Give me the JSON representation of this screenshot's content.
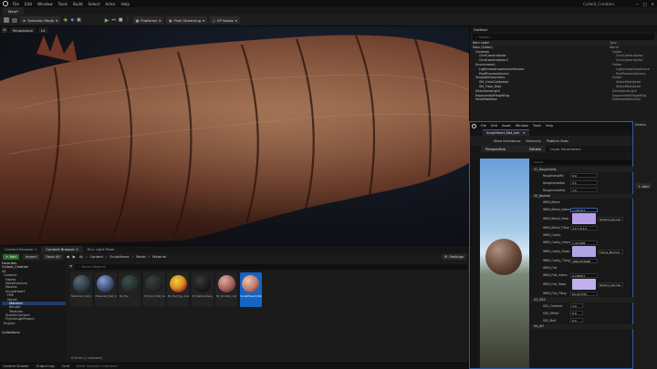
{
  "window": {
    "title": "Colloid_Creation",
    "project_tab": "Main*"
  },
  "menu": [
    "File",
    "Edit",
    "Window",
    "Tools",
    "Build",
    "Select",
    "Actor",
    "Help"
  ],
  "toolbar": {
    "mode": "Selection Mode",
    "platforms": "Platforms",
    "pixel_streaming": "Pixel Streaming",
    "vp_nodes": "VP Nodes"
  },
  "viewport": {
    "perspective": "Perspective",
    "lit": "Lit"
  },
  "content_browser": {
    "tabs": [
      "Content Browser 1",
      "Content Browser 2",
      "Env. Light Mixer"
    ],
    "add": "+ Add",
    "import": "Import",
    "save_all": "Save All",
    "breadcrumb": [
      "All",
      "Content",
      "SculptHeart",
      "Model",
      "Material"
    ],
    "search_placeholder": "Search Material",
    "settings": "Settings",
    "favorites": "Favorites",
    "project_root": "Colloid_Creation",
    "tree": [
      "All",
      "Content",
      "Hands",
      "MetaHumans",
      "Movies",
      "SculptHeart",
      "FBX",
      "Model",
      "Material",
      "Render",
      "Textures",
      "StarterContent",
      "FlythroughProject",
      "Engine"
    ],
    "assets": [
      {
        "label": "Material1_Mat_Inst",
        "color": "#2a3a44"
      },
      {
        "label": "Material2_Mat_Inst",
        "color": "#3a4a6c"
      },
      {
        "label": "MI_Eye",
        "color": "#23302e"
      },
      {
        "label": "MI_Eye2_Mat_Inst",
        "color": "#222828"
      },
      {
        "label": "MI_Mat_Eye_Inst",
        "color": "#d89020"
      },
      {
        "label": "MI_MetaSurface_inst",
        "color": "#2a2a2a"
      },
      {
        "label": "MI_SkinMat_inst",
        "color": "#a05f5a"
      },
      {
        "label": "SculptHeart_Mat_Inst",
        "color": "#b87a70"
      }
    ],
    "item_count": "8 items (1 selected)",
    "collections": "Collections"
  },
  "outliner": {
    "title": "Outliner",
    "search_placeholder": "Search...",
    "col_label": "Item Label",
    "col_type": "Type",
    "rows": [
      {
        "label": "Main (Editor)",
        "type": "World"
      },
      {
        "label": "Cameras",
        "type": "Folder"
      },
      {
        "label": "CineCameraActor",
        "type": "CineCameraActor"
      },
      {
        "label": "CineCameraActor2",
        "type": "CineCameraActor"
      },
      {
        "label": "Environment",
        "type": "Folder"
      },
      {
        "label": "LightmassImportanceVolume",
        "type": "LightmassImportance"
      },
      {
        "label": "PostProcessVolume",
        "type": "PostProcessVolume"
      },
      {
        "label": "TemplateGeometry",
        "type": "Folder"
      },
      {
        "label": "SM_CubeCalibrator",
        "type": "StaticMeshActor"
      },
      {
        "label": "SM_Floor_Disk",
        "type": "StaticMeshActor"
      },
      {
        "label": "DirectionalLight",
        "type": "DirectionalLight"
      },
      {
        "label": "ExponentialHeightFog",
        "type": "ExponentialHeightFog"
      },
      {
        "label": "HeartSkeleton",
        "type": "SkeletalMeshActor"
      }
    ]
  },
  "material_editor": {
    "menu": [
      "File",
      "Edit",
      "Asset",
      "Window",
      "Tools",
      "Help"
    ],
    "tab": "SculptHeart_Mat_Inst",
    "toolbar": [
      "Show Inheritance",
      "Hierarchy",
      "Platform Stats"
    ],
    "details_tab": "Details",
    "layer_tab": "Layer Parameters",
    "viewport_label": "Perspective",
    "search_placeholder": "Search",
    "sections": [
      "01_Roughness",
      "02_Normal",
      "03_SSS",
      "04_AO"
    ],
    "roughness": [
      {
        "name": "RoughnessMin",
        "value": "0.0"
      },
      {
        "name": "RoughnessMax",
        "value": "0.5"
      },
      {
        "name": "RoughnessMult",
        "value": "1.0"
      }
    ],
    "normal": [
      {
        "name": "WRN_Blend",
        "value": ""
      },
      {
        "name": "WRN_Blend_Intens",
        "value": "1.797977"
      },
      {
        "name": "WRN_Blend_Mask",
        "value": "Stretch_Normal"
      },
      {
        "name": "WRN_Blend_Tiling",
        "value": "4.0  1.8  4.0"
      },
      {
        "name": "WRN_Cavity",
        "value": ""
      },
      {
        "name": "WRN_Cavity_Intens",
        "value": "1.317486"
      },
      {
        "name": "WRN_Cavity_Mask",
        "value": "Tissue_Normal"
      },
      {
        "name": "WRN_Cavity_Tiling",
        "value": "1864.879988"
      },
      {
        "name": "WRN_Flat",
        "value": ""
      },
      {
        "name": "WRN_Flat_Intens",
        "value": "0.186871"
      },
      {
        "name": "WRN_Flat_Mask",
        "value": "Stretch_Normal"
      },
      {
        "name": "WRN_Flat_Tiling",
        "value": "60.417370"
      }
    ],
    "sss": [
      {
        "name": "SSS_Contrast",
        "value": "1.0"
      },
      {
        "name": "SSS_Offset",
        "value": "0.0"
      },
      {
        "name": "SSS_Mult",
        "value": "0.0"
      }
    ]
  },
  "side_panel": {
    "panel1": "Details",
    "add": "+ Add"
  },
  "status": {
    "drawer": "Content Drawer",
    "output": "Output Log",
    "cmd": "Cmd",
    "cmd_placeholder": "Enter Console Command"
  },
  "colors": {
    "accent": "#2c5da8",
    "selected": "#1464c4",
    "highlight_row": "#1f3d66"
  }
}
